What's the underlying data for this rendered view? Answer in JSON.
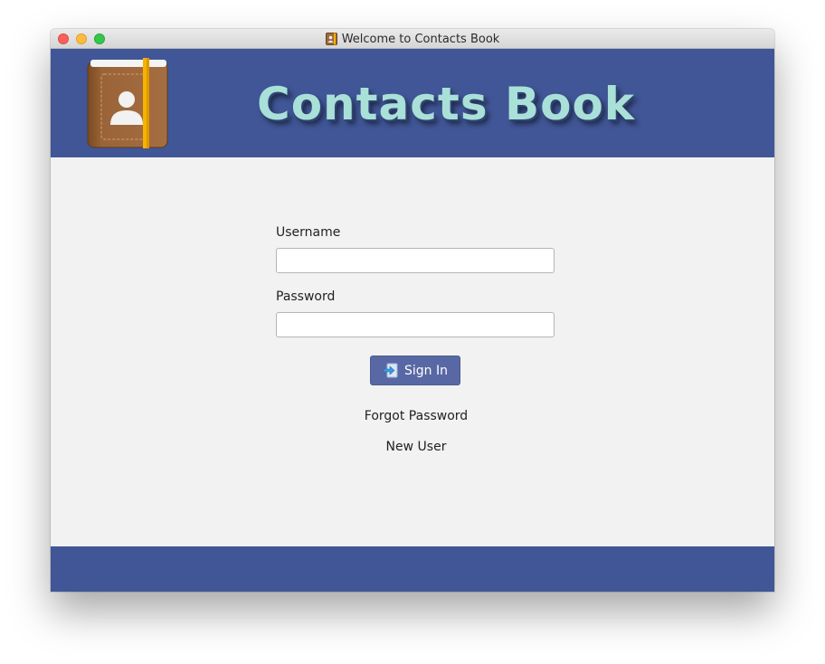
{
  "window": {
    "title": "Welcome to Contacts Book",
    "title_icon": "contacts-book-icon"
  },
  "header": {
    "brand": "Contacts Book",
    "logo_icon": "contacts-book-icon"
  },
  "form": {
    "username_label": "Username",
    "username_value": "",
    "password_label": "Password",
    "password_value": "",
    "signin_label": "Sign In",
    "signin_icon": "sign-in-arrow-icon"
  },
  "links": {
    "forgot_password": "Forgot Password",
    "new_user": "New User"
  },
  "colors": {
    "header_bg": "#405696",
    "footer_bg": "#405696",
    "button_bg": "#5868a4",
    "brand_text": "#a9e0d8",
    "content_bg": "#f2f2f2"
  }
}
